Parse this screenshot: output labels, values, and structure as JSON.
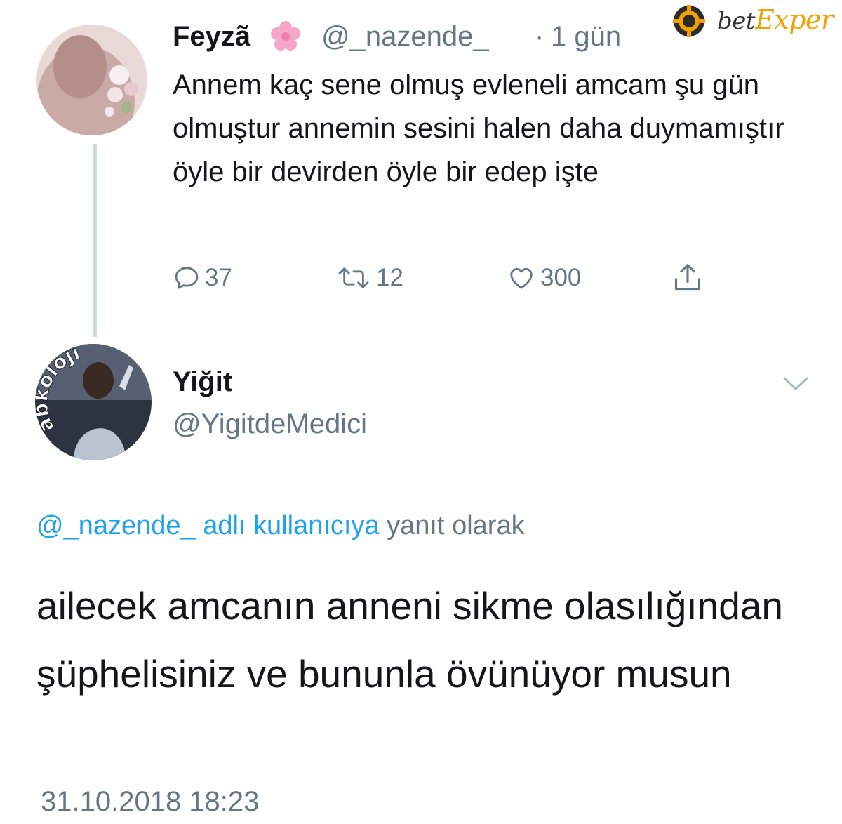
{
  "watermark": {
    "brand": "betExper",
    "brand_prefix": "bet",
    "brand_accent": "Exper",
    "accent_color": "#f2a100"
  },
  "tweet1": {
    "name": "Feyzã",
    "name_emoji_icon": "cherry-blossom-icon",
    "handle": "@_nazende_",
    "separator": "·",
    "time": "1 gün",
    "text": "Annem kaç sene olmuş evleneli amcam şu gün olmuştur annemin sesini halen daha duymamıştır öyle bir devirden öyle bir edep işte",
    "actions": {
      "reply_count": "37",
      "retweet_count": "12",
      "like_count": "300"
    }
  },
  "tweet2": {
    "name": "Yiğit",
    "handle": "@YigitdeMedici",
    "avatar_overlay_text": "abkoloji",
    "reply_to_handle": "@_nazende_",
    "reply_to_mid": " adlı kullanıcıya",
    "reply_to_suffix": " yanıt olarak",
    "text": "ailecek amcanın anneni sikme olasılığından şüphelisiniz ve bununla övünüyor musun",
    "date": "31.10.2018 18:23"
  },
  "colors": {
    "link": "#1da1f2",
    "secondary": "#657786",
    "primary_text": "#14171a"
  }
}
